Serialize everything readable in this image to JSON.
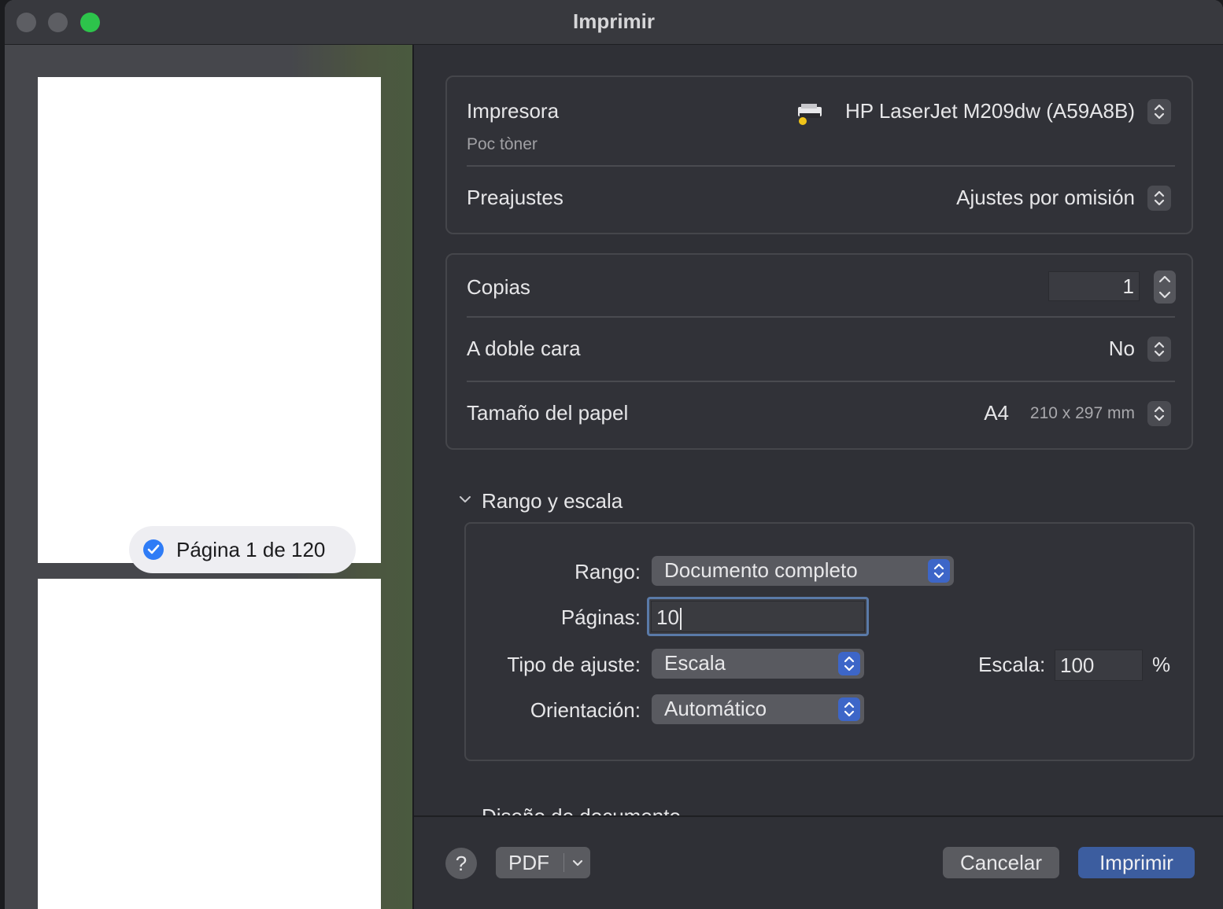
{
  "window": {
    "title": "Imprimir"
  },
  "preview": {
    "page_badge": "Página 1 de 120"
  },
  "printer": {
    "label": "Impresora",
    "status": "Poc tòner",
    "value": "HP LaserJet M209dw (A59A8B)",
    "icon": "printer-icon"
  },
  "presets": {
    "label": "Preajustes",
    "value": "Ajustes por omisión"
  },
  "copies": {
    "label": "Copias",
    "value": "1"
  },
  "duplex": {
    "label": "A doble cara",
    "value": "No"
  },
  "paper": {
    "label": "Tamaño del papel",
    "size": "A4",
    "dimensions": "210 x 297 mm"
  },
  "range_section": {
    "title": "Rango y escala",
    "range_label": "Rango:",
    "range_value": "Documento completo",
    "pages_label": "Páginas:",
    "pages_value": "10",
    "fit_label": "Tipo de ajuste:",
    "fit_value": "Escala",
    "scale_label": "Escala:",
    "scale_value": "100",
    "scale_unit": "%",
    "orientation_label": "Orientación:",
    "orientation_value": "Automático"
  },
  "next_section": {
    "title": "Diseño de documento"
  },
  "footer": {
    "help": "?",
    "pdf": "PDF",
    "cancel": "Cancelar",
    "print": "Imprimir"
  },
  "colors": {
    "accent": "#3c5d9f",
    "window_bg": "#2f3036",
    "check": "#2f7cf6"
  }
}
